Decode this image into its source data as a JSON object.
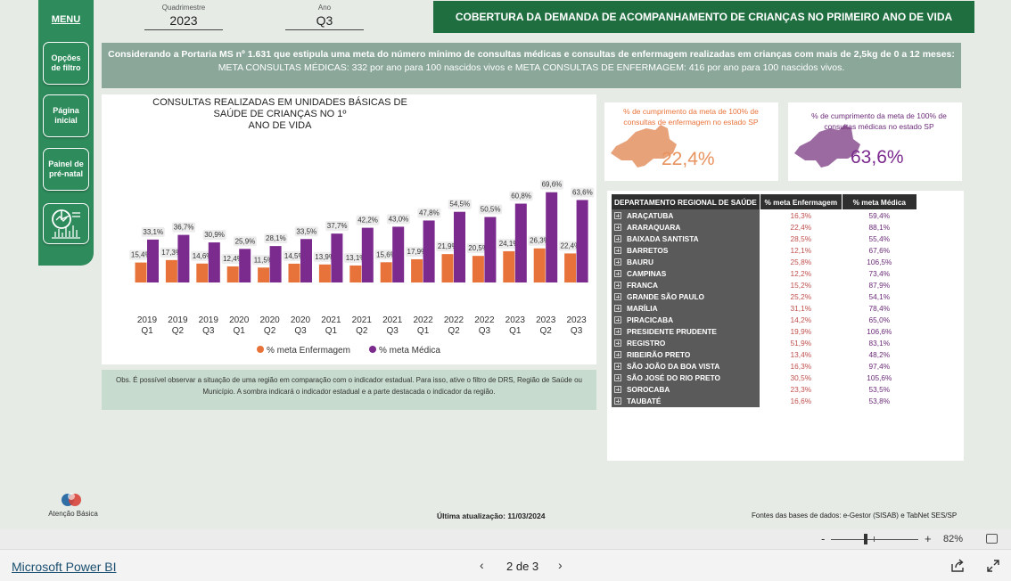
{
  "menu": {
    "title": "MENU",
    "buttons": [
      {
        "label": "Opções\nde filtro"
      },
      {
        "label": "Página\ninicial"
      },
      {
        "label": "Painel de\npré-natal"
      }
    ],
    "chart_icon": "chart-analytics-icon"
  },
  "filters": {
    "quadrimestre_label": "Quadrimestre",
    "quadrimestre_value": "2023",
    "ano_label": "Ano",
    "ano_value": "Q3"
  },
  "header": {
    "title": "COBERTURA DA DEMANDA DE ACOMPANHAMENTO DE CRIANÇAS NO PRIMEIRO ANO DE VIDA"
  },
  "info": {
    "line1": "Considerando a Portaria MS nº 1.631 que estipula uma meta do número mínimo de consultas médicas e consultas de enfermagem realizadas em crianças com mais de 2,5kg de 0 a 12 meses:",
    "line2": "META CONSULTAS MÉDICAS: 332 por ano para 100 nascidos vivos e META CONSULTAS DE ENFERMAGEM: 416 por ano para 100 nascidos vivos."
  },
  "chart_data": {
    "type": "bar",
    "title": "CONSULTAS REALIZADAS EM UNIDADES BÁSICAS DE SAÚDE DE CRIANÇAS NO 1º\nANO DE VIDA",
    "categories": [
      "2019 Q1",
      "2019 Q2",
      "2019 Q3",
      "2020 Q1",
      "2020 Q2",
      "2020 Q3",
      "2021 Q1",
      "2021 Q2",
      "2021 Q3",
      "2022 Q1",
      "2022 Q2",
      "2022 Q3",
      "2023 Q1",
      "2023 Q2",
      "2023 Q3"
    ],
    "category_years": [
      "2019",
      "2019",
      "2019",
      "2020",
      "2020",
      "2020",
      "2021",
      "2021",
      "2021",
      "2022",
      "2022",
      "2022",
      "2023",
      "2023",
      "2023"
    ],
    "category_quarters": [
      "Q1",
      "Q2",
      "Q3",
      "Q1",
      "Q2",
      "Q3",
      "Q1",
      "Q2",
      "Q3",
      "Q1",
      "Q2",
      "Q3",
      "Q1",
      "Q2",
      "Q3"
    ],
    "series": [
      {
        "name": "% meta Enfermagem",
        "color": "#e8733a",
        "values": [
          15.4,
          17.3,
          14.6,
          12.4,
          11.5,
          14.5,
          13.9,
          13.1,
          15.6,
          17.9,
          21.9,
          20.5,
          24.1,
          26.3,
          22.4
        ],
        "labels": [
          "15,4%",
          "17,3%",
          "14,6%",
          "12,4%",
          "11,5%",
          "14,5%",
          "13,9%",
          "13,1%",
          "15,6%",
          "17,9%",
          "21,9%",
          "20,5%",
          "24,1%",
          "26,3%",
          "22,4%"
        ]
      },
      {
        "name": "% meta Médica",
        "color": "#7b2a8e",
        "values": [
          33.1,
          36.7,
          30.9,
          25.9,
          28.1,
          33.5,
          37.7,
          42.2,
          43.0,
          47.8,
          54.5,
          50.5,
          60.8,
          69.6,
          63.6
        ],
        "labels": [
          "33,1%",
          "36,7%",
          "30,9%",
          "25,9%",
          "28,1%",
          "33,5%",
          "37,7%",
          "42,2%",
          "43,0%",
          "47,8%",
          "54,5%",
          "50,5%",
          "60,8%",
          "69,6%",
          "63,6%"
        ]
      }
    ],
    "legend_position": "bottom",
    "grid": false
  },
  "observation": "Obs. É possível observar a situação de uma região em comparação com o indicador estadual. Para isso, ative o filtro de DRS, Região de Saúde ou Município. A sombra indicará o indicador estadual e a parte destacada o indicador da região.",
  "kpis": [
    {
      "label": "% de cumprimento da meta de 100% de consultas de enfermagem no estado SP",
      "value": "22,4%",
      "color": "#e8925e",
      "map_color": "#e8a27a"
    },
    {
      "label": "% de cumprimento da meta de 100% de consultas médicas no estado SP",
      "value": "63,6%",
      "color": "#7b2a8e",
      "map_color": "#9a6aa0"
    }
  ],
  "table": {
    "headers": [
      "DEPARTAMENTO REGIONAL DE SAÚDE",
      "% meta Enfermagem",
      "% meta Médica"
    ],
    "rows": [
      [
        "ARAÇATUBA",
        "16,3%",
        "59,4%"
      ],
      [
        "ARARAQUARA",
        "22,4%",
        "88,1%"
      ],
      [
        "BAIXADA SANTISTA",
        "28,5%",
        "55,4%"
      ],
      [
        "BARRETOS",
        "12,1%",
        "67,6%"
      ],
      [
        "BAURU",
        "25,8%",
        "106,5%"
      ],
      [
        "CAMPINAS",
        "12,2%",
        "73,4%"
      ],
      [
        "FRANCA",
        "15,2%",
        "87,9%"
      ],
      [
        "GRANDE SÃO PAULO",
        "25,2%",
        "54,1%"
      ],
      [
        "MARÍLIA",
        "31,1%",
        "78,4%"
      ],
      [
        "PIRACICABA",
        "14,2%",
        "65,0%"
      ],
      [
        "PRESIDENTE PRUDENTE",
        "19,9%",
        "106,6%"
      ],
      [
        "REGISTRO",
        "51,9%",
        "83,1%"
      ],
      [
        "RIBEIRÃO PRETO",
        "13,4%",
        "48,2%"
      ],
      [
        "SÃO JOÃO DA BOA VISTA",
        "16,3%",
        "97,4%"
      ],
      [
        "SÃO JOSÉ DO RIO PRETO",
        "30,5%",
        "105,6%"
      ],
      [
        "SOROCABA",
        "23,3%",
        "53,5%"
      ],
      [
        "TAUBATÉ",
        "16,6%",
        "53,8%"
      ]
    ]
  },
  "footer": {
    "logo_text": "Atenção Básica",
    "update": "Última atualização: 11/03/2024",
    "sources": "Fontes das bases de dados: e-Gestor (SISAB) e TabNet SES/SP",
    "zoom": "82%",
    "app_link": "Microsoft Power BI",
    "page": "2 de 3"
  }
}
